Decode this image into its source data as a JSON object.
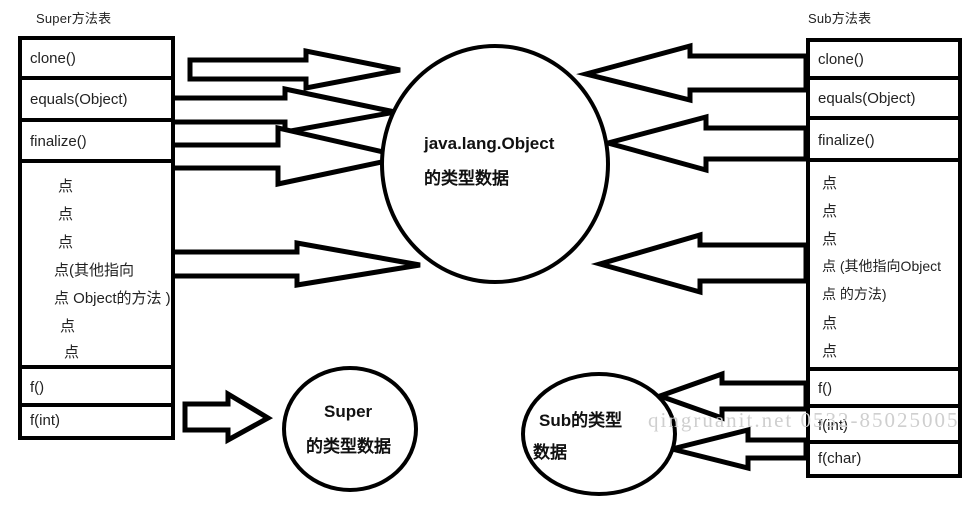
{
  "diagram": {
    "title_left": "Super方法表",
    "title_right": "Sub方法表",
    "watermark": "qingruanit.net 0532-85025005"
  },
  "super_table": {
    "caption": "Super方法表",
    "rows": [
      {
        "label": "clone()"
      },
      {
        "label": "equals(Object)"
      },
      {
        "label": "finalize()"
      }
    ],
    "dots_block": {
      "lines": [
        "点",
        "点",
        "点",
        "点(其他指向",
        "点 Object的方法 )",
        "点",
        "点"
      ]
    },
    "tail_rows": [
      {
        "label": "f()"
      },
      {
        "label": "f(int)"
      }
    ]
  },
  "sub_table": {
    "caption": "Sub方法表",
    "rows": [
      {
        "label": "clone()"
      },
      {
        "label": "equals(Object)"
      },
      {
        "label": "finalize()"
      }
    ],
    "dots_block": {
      "lines": [
        "点",
        "点",
        "点",
        "点 (其他指向Object",
        "点 的方法)",
        "点",
        "点"
      ]
    },
    "tail_rows": [
      {
        "label": "f()"
      },
      {
        "label": "f(int)"
      },
      {
        "label": "f(char)"
      }
    ]
  },
  "bubbles": {
    "object": {
      "line1": "java.lang.Object",
      "line2": "的类型数据"
    },
    "super": {
      "line1": "Super",
      "line2": "的类型数据"
    },
    "sub": {
      "line1": "Sub的类型",
      "line2": "数据"
    }
  },
  "colors": {
    "stroke": "#000000",
    "fill": "#ffffff",
    "text": "#222222",
    "watermark": "#cfcfcf"
  }
}
